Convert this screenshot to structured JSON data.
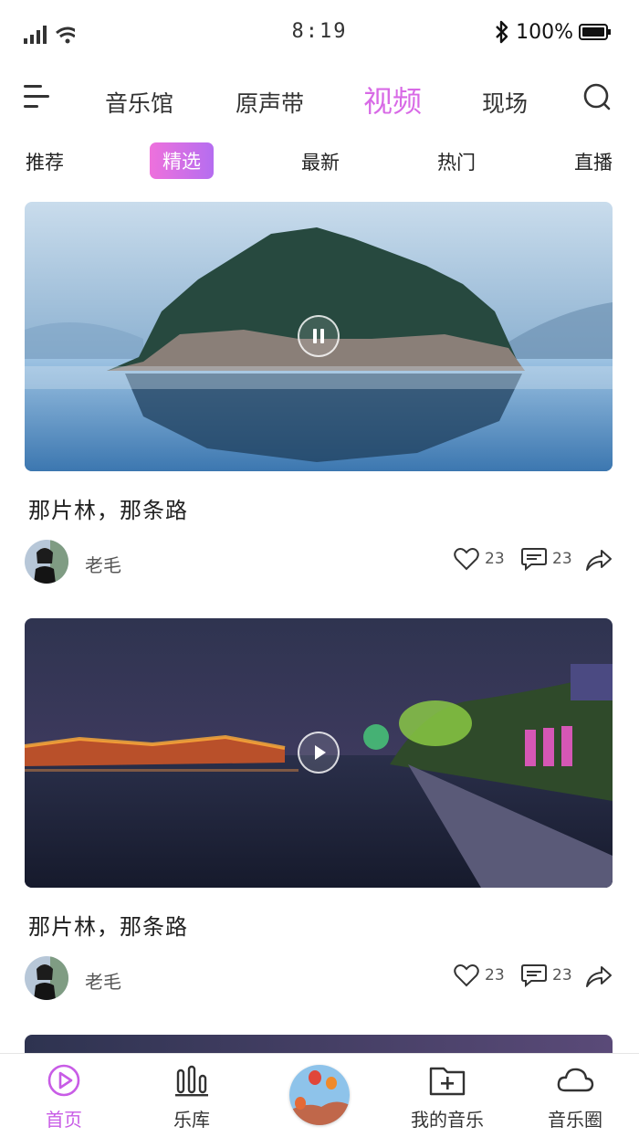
{
  "status_bar": {
    "time": "8:19",
    "battery": "100%"
  },
  "top_nav": {
    "tabs": [
      "音乐馆",
      "原声带",
      "视频",
      "现场"
    ],
    "active_index": 2
  },
  "sub_tabs": {
    "items": [
      "推荐",
      "精选",
      "最新",
      "热门",
      "直播"
    ],
    "active_index": 1
  },
  "videos": [
    {
      "title": "那片林，那条路",
      "author": "老毛",
      "likes": "23",
      "comments": "23",
      "state": "pause-icon"
    },
    {
      "title": "那片林，那条路",
      "author": "老毛",
      "likes": "23",
      "comments": "23",
      "state": "play-icon"
    }
  ],
  "bottom_nav": {
    "items": [
      "首页",
      "乐库",
      "我的音乐",
      "音乐圈"
    ],
    "active_index": 0
  },
  "colors": {
    "accent": "#d86ae6",
    "accent_gradient_start": "#ee71dc",
    "accent_gradient_end": "#b56df0"
  }
}
